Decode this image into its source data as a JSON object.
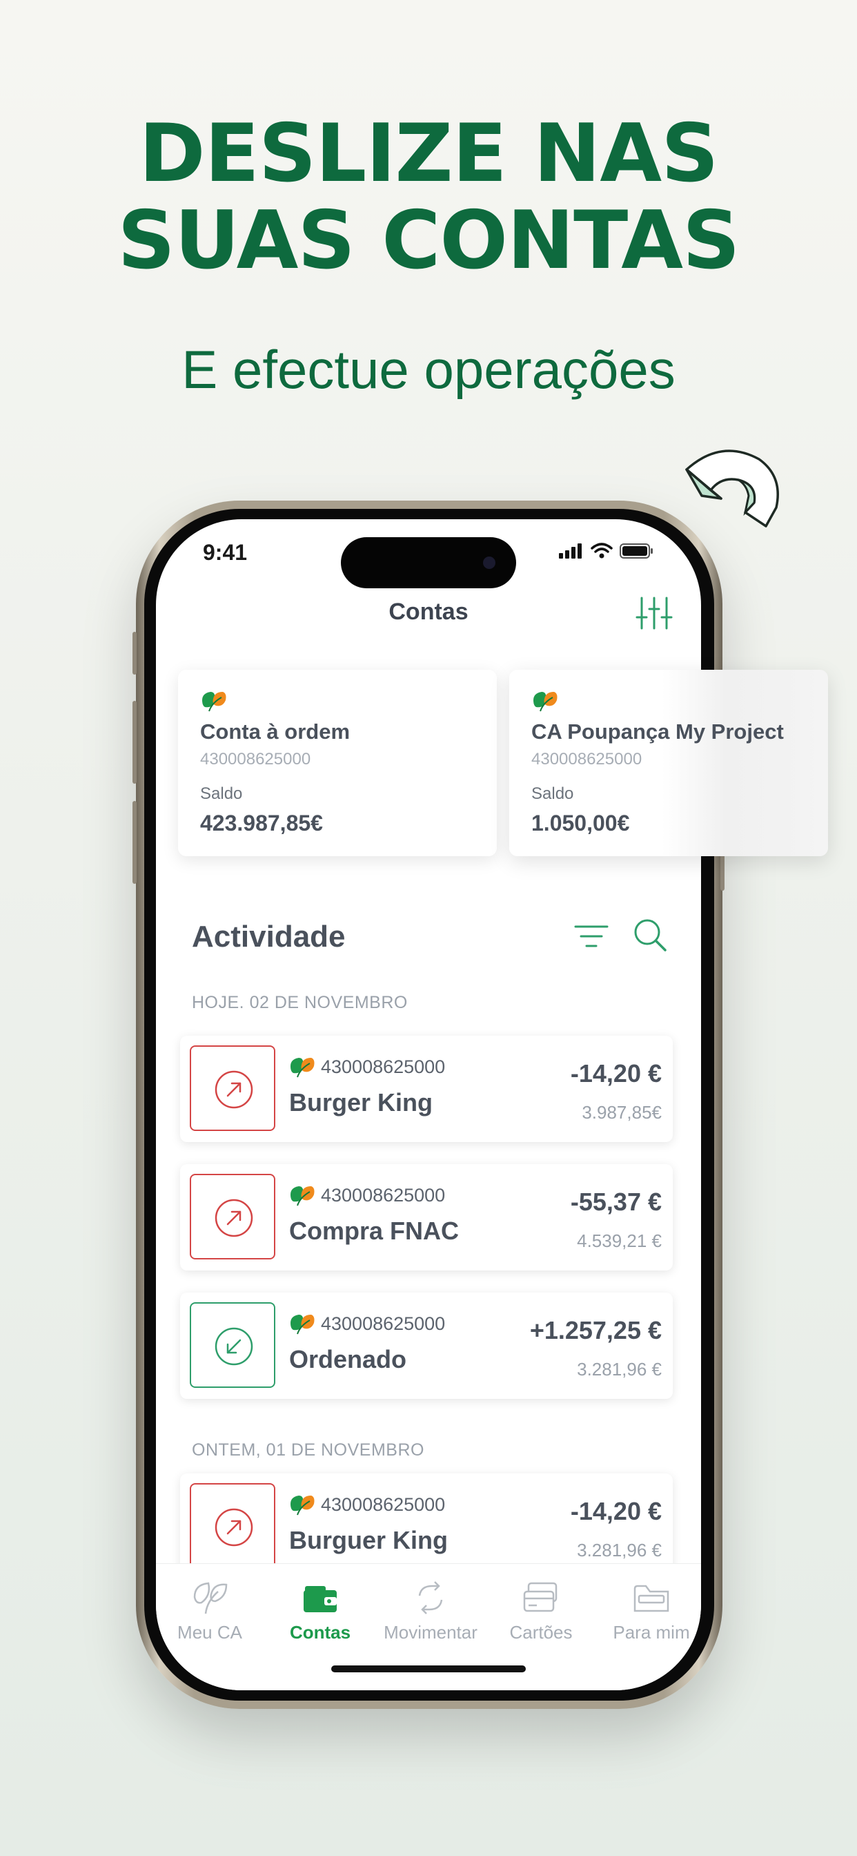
{
  "promo": {
    "headline_line1": "DESLIZE NAS",
    "headline_line2": "SUAS CONTAS",
    "subheadline": "E efectue operações"
  },
  "status_bar": {
    "time": "9:41"
  },
  "header": {
    "title": "Contas"
  },
  "accounts": [
    {
      "name": "Conta à ordem",
      "number": "430008625000",
      "balance_label": "Saldo",
      "balance": "423.987,85€"
    },
    {
      "name": "CA Poupança My Project",
      "number": "430008625000",
      "balance_label": "Saldo",
      "balance": "1.050,00€"
    }
  ],
  "activity": {
    "title": "Actividade",
    "groups": [
      {
        "date": "HOJE. 02 DE NOVEMBRO",
        "items": [
          {
            "account": "430008625000",
            "name": "Burger King",
            "amount": "-14,20 €",
            "balance": "3.987,85€",
            "direction": "out"
          },
          {
            "account": "430008625000",
            "name": "Compra FNAC",
            "amount": "-55,37 €",
            "balance": "4.539,21 €",
            "direction": "out"
          },
          {
            "account": "430008625000",
            "name": "Ordenado",
            "amount": "+1.257,25 €",
            "balance": "3.281,96 €",
            "direction": "in"
          }
        ]
      },
      {
        "date": "ONTEM, 01 DE NOVEMBRO",
        "items": [
          {
            "account": "430008625000",
            "name": "Burguer King",
            "amount": "-14,20 €",
            "balance": "3.281,96 €",
            "direction": "out"
          }
        ]
      }
    ]
  },
  "tab_bar": {
    "tabs": [
      {
        "label": "Meu CA",
        "icon": "leaf-icon",
        "active": false
      },
      {
        "label": "Contas",
        "icon": "wallet-icon",
        "active": true
      },
      {
        "label": "Movimentar",
        "icon": "transfer-arrows-icon",
        "active": false
      },
      {
        "label": "Cartões",
        "icon": "cards-icon",
        "active": false
      },
      {
        "label": "Para mim",
        "icon": "folder-icon",
        "active": false
      }
    ]
  },
  "colors": {
    "brand_green": "#0e6a3e",
    "accent_green": "#1d9a4c",
    "outgoing_red": "#d44545",
    "incoming_green": "#2e9e6b",
    "logo_orange": "#f08a1c"
  }
}
